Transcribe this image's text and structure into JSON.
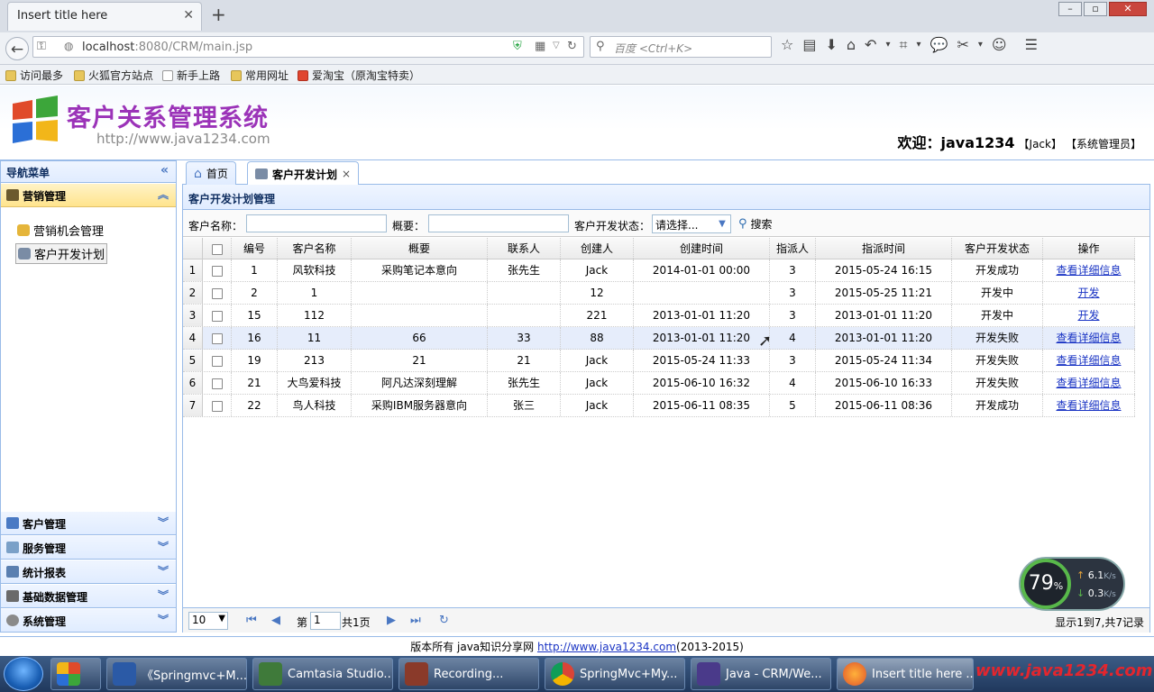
{
  "browser": {
    "tab_title": "Insert title here",
    "url_host": "localhost",
    "url_rest": ":8080/CRM/main.jsp",
    "search_placeholder": "百度 <Ctrl+K>",
    "bookmarks": [
      "访问最多",
      "火狐官方站点",
      "新手上路",
      "常用网址",
      "爱淘宝（原淘宝特卖）"
    ]
  },
  "header": {
    "title": "客户关系管理系统",
    "url": "http://www.java1234.com",
    "welcome": "欢迎：java1234",
    "user_name": "【Jack】",
    "user_role": "【系统管理员】"
  },
  "sidebar": {
    "title": "导航菜单",
    "active_group": "营销管理",
    "sub_items": [
      "营销机会管理",
      "客户开发计划"
    ],
    "groups": [
      "客户管理",
      "服务管理",
      "统计报表",
      "基础数据管理",
      "系统管理"
    ]
  },
  "tabs": {
    "home": "首页",
    "plan": "客户开发计划",
    "close": "×"
  },
  "panel": {
    "title": "客户开发计划管理",
    "filter": {
      "customer_label": "客户名称：",
      "overview_label": "概要：",
      "status_label": "客户开发状态：",
      "status_value": "请选择...",
      "search_label": "搜索"
    }
  },
  "grid": {
    "columns": [
      "编号",
      "客户名称",
      "概要",
      "联系人",
      "创建人",
      "创建时间",
      "指派人",
      "指派时间",
      "客户开发状态",
      "操作"
    ],
    "rows": [
      {
        "n": "1",
        "id": "1",
        "customer": "风软科技",
        "overview": "采购笔记本意向",
        "contact": "张先生",
        "creator": "Jack",
        "created": "2014-01-01 00:00",
        "assignee": "3",
        "assigned": "2015-05-24 16:15",
        "status": "开发成功",
        "action": "查看详细信息"
      },
      {
        "n": "2",
        "id": "2",
        "customer": "1",
        "overview": "",
        "contact": "",
        "creator": "12",
        "created": "",
        "assignee": "3",
        "assigned": "2015-05-25 11:21",
        "status": "开发中",
        "action": "开发"
      },
      {
        "n": "3",
        "id": "15",
        "customer": "112",
        "overview": "",
        "contact": "",
        "creator": "221",
        "created": "2013-01-01 11:20",
        "assignee": "3",
        "assigned": "2013-01-01 11:20",
        "status": "开发中",
        "action": "开发"
      },
      {
        "n": "4",
        "id": "16",
        "customer": "11",
        "overview": "66",
        "contact": "33",
        "creator": "88",
        "created": "2013-01-01 11:20",
        "assignee": "4",
        "assigned": "2013-01-01 11:20",
        "status": "开发失败",
        "action": "查看详细信息"
      },
      {
        "n": "5",
        "id": "19",
        "customer": "213",
        "overview": "21",
        "contact": "21",
        "creator": "Jack",
        "created": "2015-05-24 11:33",
        "assignee": "3",
        "assigned": "2015-05-24 11:34",
        "status": "开发失败",
        "action": "查看详细信息"
      },
      {
        "n": "6",
        "id": "21",
        "customer": "大鸟爱科技",
        "overview": "阿凡达深刻理解",
        "contact": "张先生",
        "creator": "Jack",
        "created": "2015-06-10 16:32",
        "assignee": "4",
        "assigned": "2015-06-10 16:33",
        "status": "开发失败",
        "action": "查看详细信息"
      },
      {
        "n": "7",
        "id": "22",
        "customer": "鸟人科技",
        "overview": "采购IBM服务器意向",
        "contact": "张三",
        "creator": "Jack",
        "created": "2015-06-11 08:35",
        "assignee": "5",
        "assigned": "2015-06-11 08:36",
        "status": "开发成功",
        "action": "查看详细信息"
      }
    ]
  },
  "pager": {
    "page_size": "10",
    "page_prefix": "第",
    "page": "1",
    "page_total": "共1页",
    "summary": "显示1到7,共7记录"
  },
  "footer": {
    "text": "版本所有 java知识分享网 ",
    "link": "http://www.java1234.com",
    "years": "(2013-2015)"
  },
  "netwidget": {
    "cpu": "79",
    "cpu_unit": "%",
    "up": "6.1",
    "down": "0.3",
    "unit": "K/s"
  },
  "taskbar": {
    "items": [
      "《Springmvc+M...",
      "Camtasia Studio...",
      "Recording...",
      "SpringMvc+My...",
      "Java - CRM/We...",
      "Insert title here ..."
    ],
    "watermark": "www.java1234.com"
  },
  "colors": {
    "accent": "#99bbe8",
    "title": "#9b33b8",
    "link": "#1a34c4"
  }
}
